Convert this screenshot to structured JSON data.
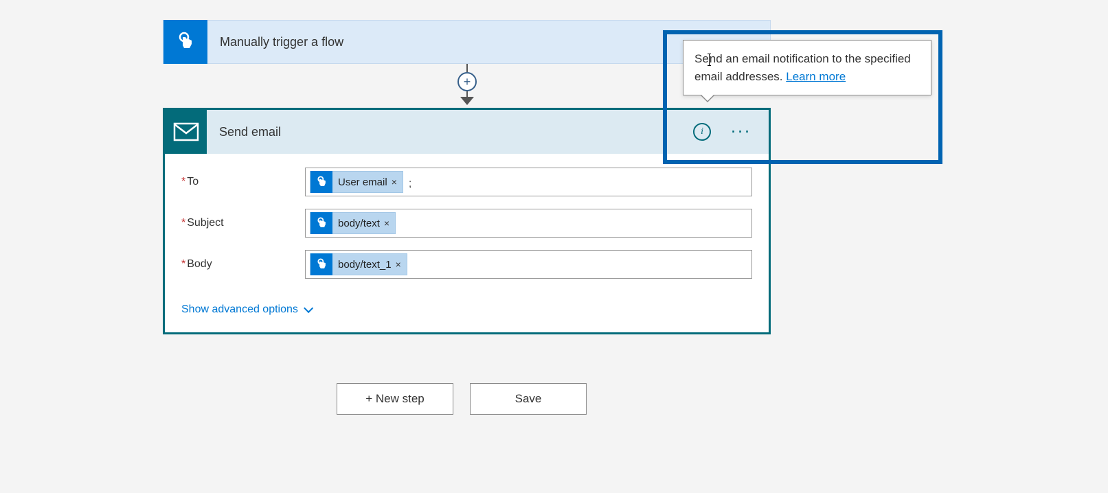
{
  "trigger": {
    "title": "Manually trigger a flow",
    "icon": "touch-icon"
  },
  "action": {
    "title": "Send email",
    "icon": "mail-icon",
    "fields": {
      "to": {
        "label": "To",
        "token_label": "User email",
        "token_icon": "touch-icon",
        "separator": ";"
      },
      "subject": {
        "label": "Subject",
        "token_label": "body/text",
        "token_icon": "touch-icon"
      },
      "body": {
        "label": "Body",
        "token_label": "body/text_1",
        "token_icon": "touch-icon"
      }
    },
    "advanced_label": "Show advanced options"
  },
  "tooltip": {
    "text_before": "Se",
    "text_after": "nd an email notification to the specified email addresses. ",
    "link_label": "Learn more"
  },
  "footer": {
    "new_step_label": "+ New step",
    "save_label": "Save"
  },
  "colors": {
    "accent_blue": "#0078d4",
    "teal": "#036b7a",
    "highlight": "#0063b1"
  }
}
